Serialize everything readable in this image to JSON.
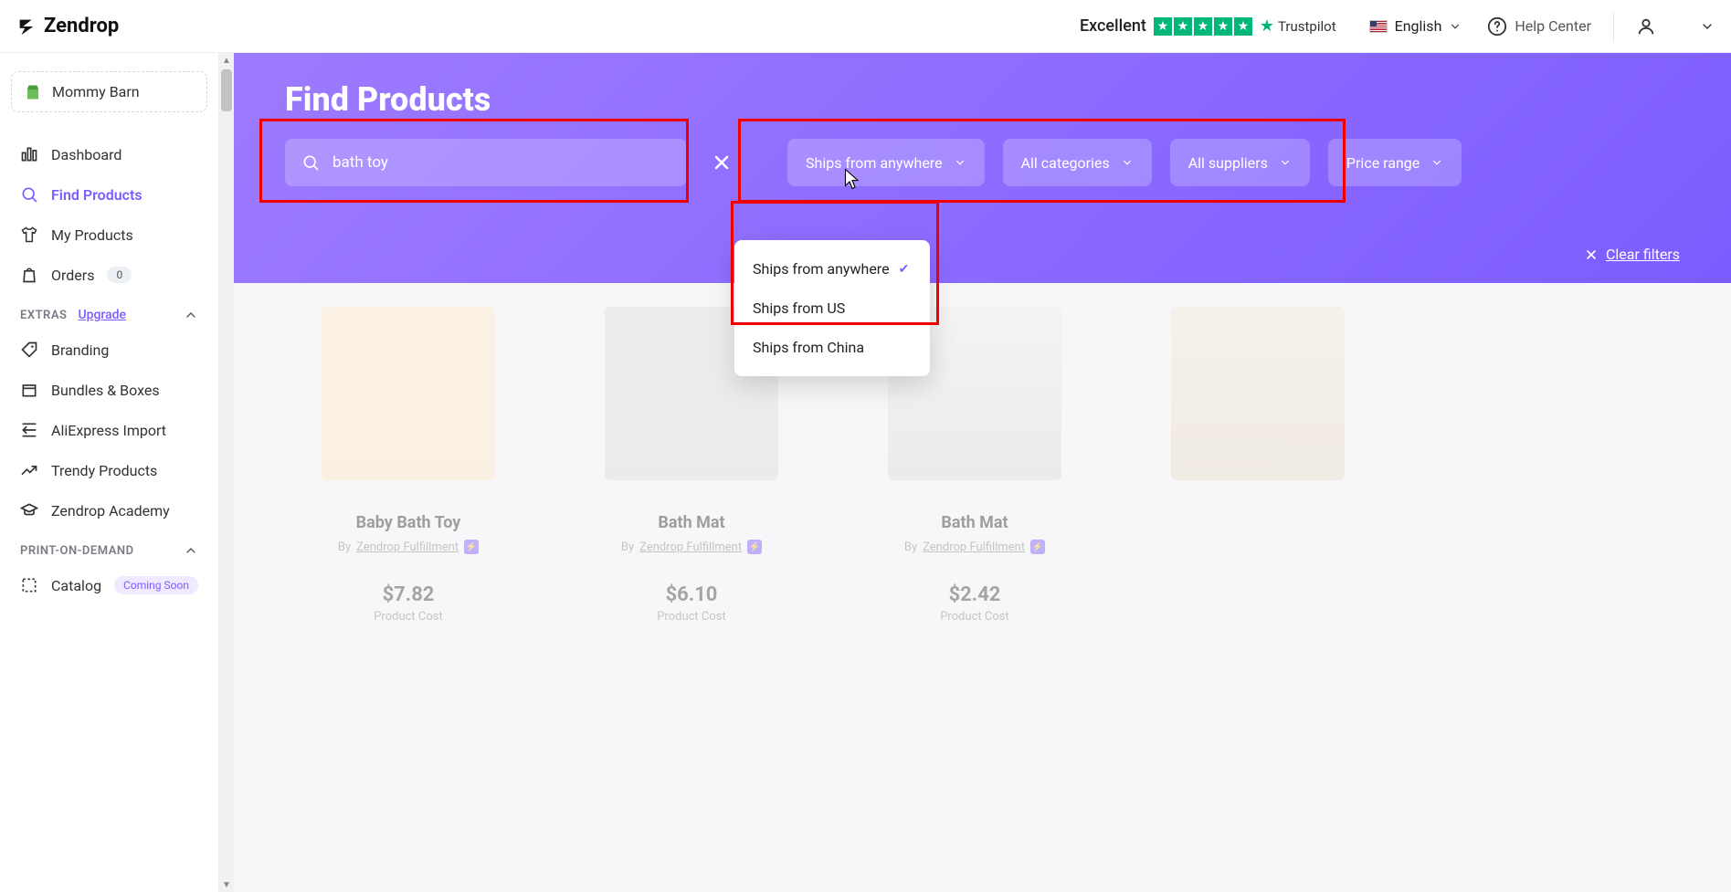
{
  "brand": "Zendrop",
  "topbar": {
    "rating_label": "Excellent",
    "trustpilot": "Trustpilot",
    "language": "English",
    "help_center": "Help Center"
  },
  "sidebar": {
    "store_name": "Mommy Barn",
    "nav": {
      "dashboard": "Dashboard",
      "find_products": "Find Products",
      "my_products": "My Products",
      "orders": "Orders",
      "orders_count": "0"
    },
    "extras_header": "EXTRAS",
    "upgrade_label": "Upgrade",
    "extras": {
      "branding": "Branding",
      "bundles": "Bundles & Boxes",
      "aliexpress": "AliExpress Import",
      "trendy": "Trendy Products",
      "academy": "Zendrop Academy"
    },
    "pod_header": "PRINT-ON-DEMAND",
    "pod": {
      "catalog": "Catalog",
      "coming_soon": "Coming Soon"
    }
  },
  "hero": {
    "title": "Find Products",
    "search_value": "bath toy",
    "filters": {
      "ships": "Ships from anywhere",
      "categories": "All categories",
      "suppliers": "All suppliers",
      "price": "Price range"
    },
    "clear_filters": "Clear filters"
  },
  "ships_dropdown": {
    "anywhere": "Ships from anywhere",
    "us": "Ships from US",
    "china": "Ships from China"
  },
  "products": {
    "by_label": "By",
    "supplier": "Zendrop Fulfillment",
    "cost_label": "Product Cost",
    "items": [
      {
        "title": "Baby Bath Toy",
        "price": "$7.82"
      },
      {
        "title": "Bath Mat",
        "price": "$6.10"
      },
      {
        "title": "Bath Mat",
        "price": "$2.42"
      },
      {
        "title": "",
        "price": ""
      }
    ]
  }
}
